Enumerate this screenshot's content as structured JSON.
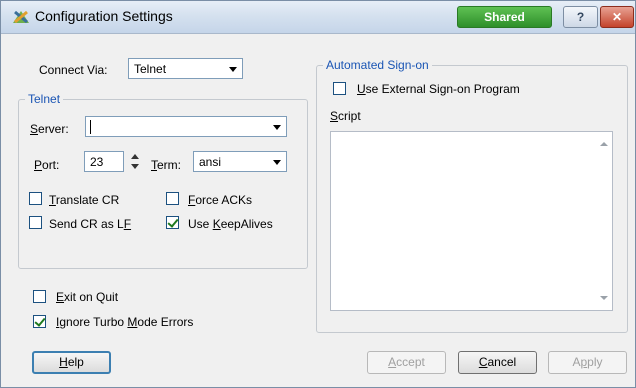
{
  "window": {
    "title": "Configuration Settings",
    "badge": "Shared",
    "help_glyph": "?",
    "close_glyph": "✕"
  },
  "connect": {
    "label": "Connect Via:",
    "value": "Telnet"
  },
  "telnet": {
    "group_title": "Telnet",
    "server_label": "Server:",
    "server_value": "",
    "port_label": "Port:",
    "port_value": "23",
    "term_label": "Term:",
    "term_value": "ansi",
    "options": [
      {
        "label": "Translate CR",
        "checked": false
      },
      {
        "label": "Force ACKs",
        "checked": false
      },
      {
        "label": "Send CR as LF",
        "checked": false
      },
      {
        "label": "Use KeepAlives",
        "checked": true
      }
    ]
  },
  "general": [
    {
      "label": "Exit on Quit",
      "checked": false
    },
    {
      "label": "Ignore Turbo Mode Errors",
      "checked": true
    }
  ],
  "signon": {
    "group_title": "Automated Sign-on",
    "use_external_label": "Use External Sign-on Program",
    "use_external_checked": false,
    "script_label": "Script",
    "script_value": ""
  },
  "buttons": {
    "help": "Help",
    "accept": "Accept",
    "cancel": "Cancel",
    "apply": "Apply"
  },
  "colors": {
    "group_title": "#1a55b4",
    "shared_badge": "#3aa336",
    "close_button": "#c4432b"
  }
}
